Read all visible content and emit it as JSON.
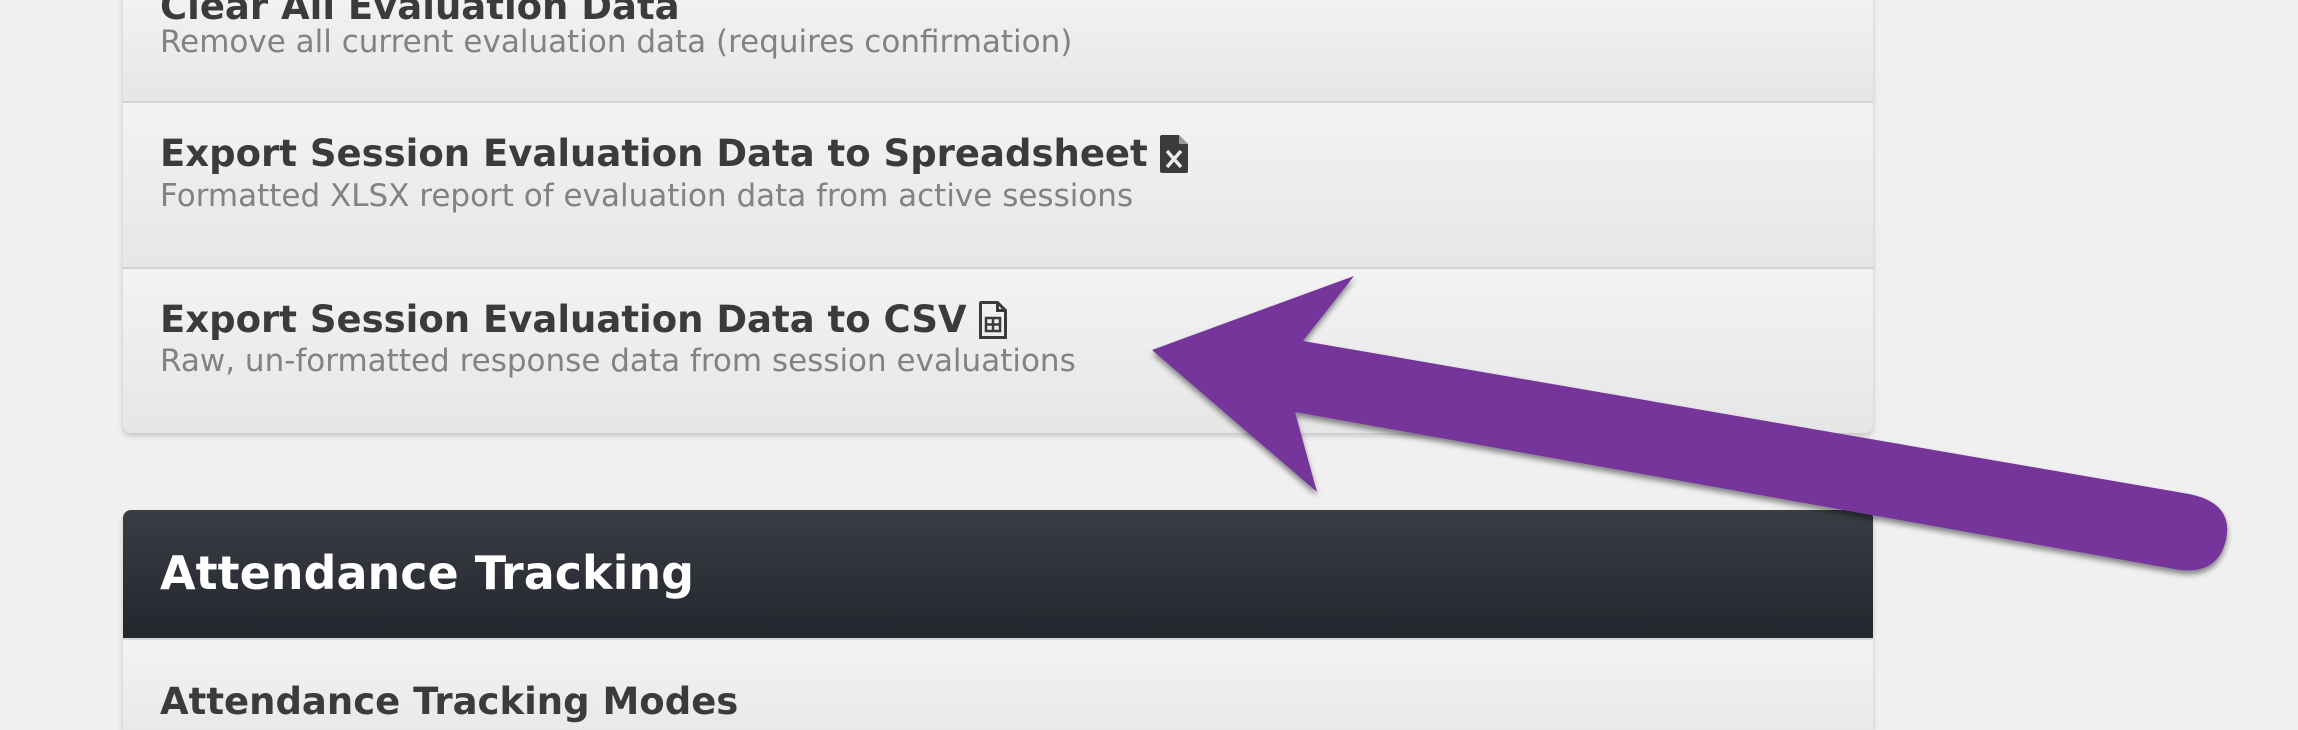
{
  "sections": {
    "evaluation": {
      "rows": [
        {
          "title": "Clear All Evaluation Data",
          "description": "Remove all current evaluation data (requires confirmation)"
        },
        {
          "title": "Export Session Evaluation Data to Spreadsheet",
          "description": "Formatted XLSX report of evaluation data from active sessions",
          "icon": "excel-file-icon"
        },
        {
          "title": "Export Session Evaluation Data to CSV",
          "description": "Raw, un-formatted response data from session evaluations",
          "icon": "csv-file-icon"
        }
      ]
    },
    "attendance": {
      "header": "Attendance Tracking",
      "rows": [
        {
          "title": "Attendance Tracking Modes"
        }
      ]
    }
  },
  "annotation": {
    "type": "arrow-icon",
    "color": "#76359b"
  }
}
